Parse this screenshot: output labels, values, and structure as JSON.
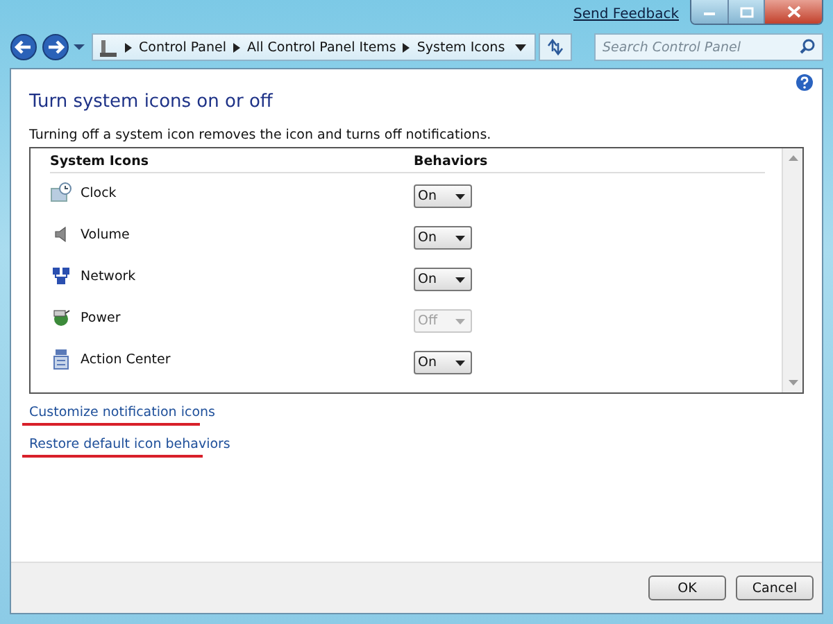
{
  "window": {
    "feedback_link": "Send Feedback"
  },
  "breadcrumb": [
    "Control Panel",
    "All Control Panel Items",
    "System Icons"
  ],
  "search": {
    "placeholder": "Search Control Panel"
  },
  "page": {
    "title": "Turn system icons on or off",
    "description": "Turning off a system icon removes the icon and turns off notifications."
  },
  "table": {
    "columns": [
      "System Icons",
      "Behaviors"
    ],
    "rows": [
      {
        "kind": "clock",
        "name": "Clock",
        "behavior": "On",
        "disabled": false
      },
      {
        "kind": "volume",
        "name": "Volume",
        "behavior": "On",
        "disabled": false
      },
      {
        "kind": "network",
        "name": "Network",
        "behavior": "On",
        "disabled": false
      },
      {
        "kind": "power",
        "name": "Power",
        "behavior": "Off",
        "disabled": true
      },
      {
        "kind": "action-center",
        "name": "Action Center",
        "behavior": "On",
        "disabled": false
      }
    ]
  },
  "links": [
    {
      "label": "Customize notification icons",
      "highlighted": true
    },
    {
      "label": "Restore default icon behaviors",
      "highlighted": true
    }
  ],
  "buttons": [
    "OK",
    "Cancel"
  ]
}
